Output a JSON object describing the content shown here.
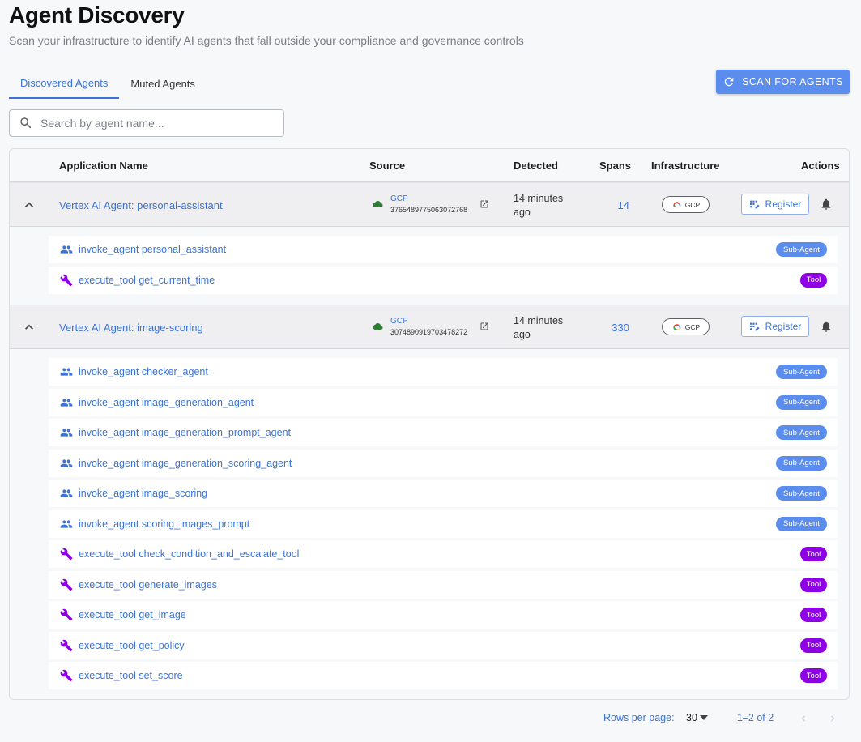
{
  "page": {
    "title": "Agent Discovery",
    "subtitle": "Scan your infrastructure to identify AI agents that fall outside your compliance and governance controls"
  },
  "tabs": [
    {
      "label": "Discovered Agents",
      "active": true
    },
    {
      "label": "Muted Agents",
      "active": false
    }
  ],
  "scan_button": {
    "label": "SCAN FOR AGENTS",
    "icon": "refresh-icon"
  },
  "search": {
    "placeholder": "Search by agent name...",
    "value": ""
  },
  "table": {
    "headers": {
      "application_name": "Application Name",
      "source": "Source",
      "detected": "Detected",
      "spans": "Spans",
      "infrastructure": "Infrastructure",
      "actions": "Actions"
    },
    "agents": [
      {
        "name": "Vertex AI Agent: personal-assistant",
        "source_label": "GCP",
        "source_id": "3765489775063072768",
        "detected": "14 minutes ago",
        "spans": "14",
        "infrastructure": "GCP",
        "register_label": "Register",
        "children": [
          {
            "type": "sub-agent",
            "label": "invoke_agent personal_assistant",
            "badge": "Sub-Agent"
          },
          {
            "type": "tool",
            "label": "execute_tool get_current_time",
            "badge": "Tool"
          }
        ]
      },
      {
        "name": "Vertex AI Agent: image-scoring",
        "source_label": "GCP",
        "source_id": "3074890919703478272",
        "detected": "14 minutes ago",
        "spans": "330",
        "infrastructure": "GCP",
        "register_label": "Register",
        "children": [
          {
            "type": "sub-agent",
            "label": "invoke_agent checker_agent",
            "badge": "Sub-Agent"
          },
          {
            "type": "sub-agent",
            "label": "invoke_agent image_generation_agent",
            "badge": "Sub-Agent"
          },
          {
            "type": "sub-agent",
            "label": "invoke_agent image_generation_prompt_agent",
            "badge": "Sub-Agent"
          },
          {
            "type": "sub-agent",
            "label": "invoke_agent image_generation_scoring_agent",
            "badge": "Sub-Agent"
          },
          {
            "type": "sub-agent",
            "label": "invoke_agent image_scoring",
            "badge": "Sub-Agent"
          },
          {
            "type": "sub-agent",
            "label": "invoke_agent scoring_images_prompt",
            "badge": "Sub-Agent"
          },
          {
            "type": "tool",
            "label": "execute_tool check_condition_and_escalate_tool",
            "badge": "Tool"
          },
          {
            "type": "tool",
            "label": "execute_tool generate_images",
            "badge": "Tool"
          },
          {
            "type": "tool",
            "label": "execute_tool get_image",
            "badge": "Tool"
          },
          {
            "type": "tool",
            "label": "execute_tool get_policy",
            "badge": "Tool"
          },
          {
            "type": "tool",
            "label": "execute_tool set_score",
            "badge": "Tool"
          }
        ]
      }
    ]
  },
  "pagination": {
    "rows_per_page_label": "Rows per page:",
    "rows_per_page": "30",
    "range": "1–2 of 2"
  },
  "colors": {
    "accent": "#3b73d6",
    "button": "#5b8def",
    "sub_agent_badge": "#5b8def",
    "tool_badge": "#8f00e6",
    "gcp_cloud": "#2e7d32"
  }
}
